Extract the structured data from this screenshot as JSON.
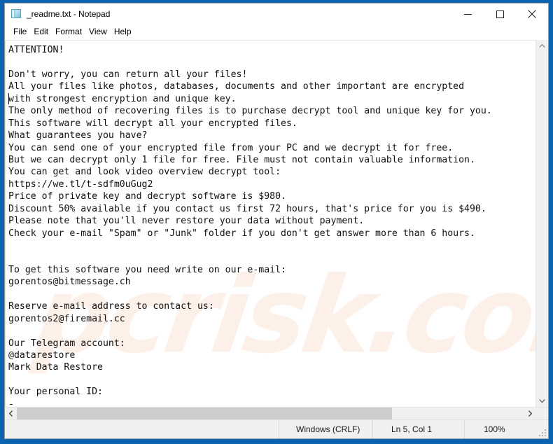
{
  "window": {
    "title": "_readme.txt - Notepad",
    "icon": "notepad-document-icon",
    "minimize_label": "—",
    "maximize_label": "□",
    "close_label": "✕"
  },
  "menubar": {
    "items": [
      {
        "label": "File"
      },
      {
        "label": "Edit"
      },
      {
        "label": "Format"
      },
      {
        "label": "View"
      },
      {
        "label": "Help"
      }
    ]
  },
  "document": {
    "filename": "_readme.txt",
    "watermark": "pcrisk.com",
    "lines": [
      "ATTENTION!",
      "",
      "Don't worry, you can return all your files!",
      "All your files like photos, databases, documents and other important are encrypted",
      "with strongest encryption and unique key.",
      "The only method of recovering files is to purchase decrypt tool and unique key for you.",
      "This software will decrypt all your encrypted files.",
      "What guarantees you have?",
      "You can send one of your encrypted file from your PC and we decrypt it for free.",
      "But we can decrypt only 1 file for free. File must not contain valuable information.",
      "You can get and look video overview decrypt tool:",
      "https://we.tl/t-sdfm0uGug2",
      "Price of private key and decrypt software is $980.",
      "Discount 50% available if you contact us first 72 hours, that's price for you is $490.",
      "Please note that you'll never restore your data without payment.",
      "Check your e-mail \"Spam\" or \"Junk\" folder if you don't get answer more than 6 hours.",
      "",
      "",
      "To get this software you need write on our e-mail:",
      "gorentos@bitmessage.ch",
      "",
      "Reserve e-mail address to contact us:",
      "gorentos2@firemail.cc",
      "",
      "Our Telegram account:",
      "@datarestore",
      "Mark Data Restore",
      "",
      "Your personal ID:",
      "-"
    ]
  },
  "scrollbars": {
    "vertical_up_arrow": "chevron-up-icon",
    "vertical_down_arrow": "chevron-down-icon",
    "horizontal_left_arrow": "chevron-left-icon",
    "horizontal_right_arrow": "chevron-right-icon"
  },
  "statusbar": {
    "line_ending": "Windows (CRLF)",
    "cursor_position": "Ln 5, Col 1",
    "zoom": "100%"
  },
  "colors": {
    "desktop_blue": "#0c64b0",
    "window_bg": "#ffffff",
    "chrome_gray": "#f0f0f0",
    "scroll_thumb": "#cdcdcd",
    "watermark": "#fdf0e8"
  }
}
